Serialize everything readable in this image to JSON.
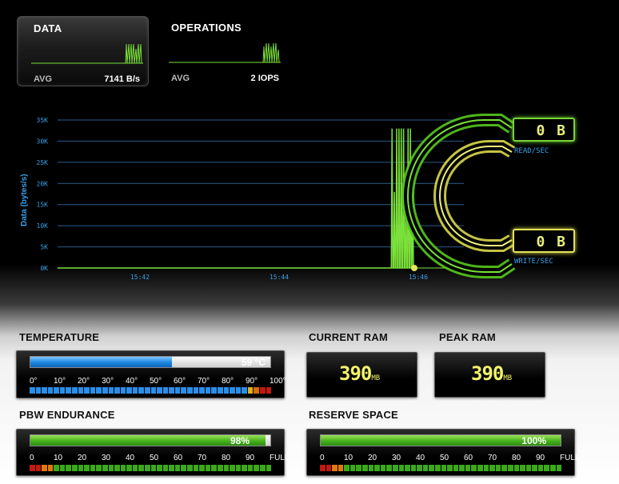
{
  "tabs": [
    {
      "title": "DATA",
      "avg_label": "AVG",
      "avg_value": "7141 B/s"
    },
    {
      "title": "OPERATIONS",
      "avg_label": "AVG",
      "avg_value": "2 IOPS"
    }
  ],
  "chart_data": {
    "type": "line",
    "ylabel": "Data (bytes/s)",
    "yticks": [
      "0K",
      "5K",
      "10K",
      "15K",
      "20K",
      "25K",
      "30K",
      "35K"
    ],
    "ylim": [
      0,
      35000
    ],
    "xticks": [
      "15:42",
      "15:44",
      "15:46"
    ],
    "series": [
      {
        "values": [
          0,
          0,
          0,
          0,
          0,
          0,
          0,
          0,
          0,
          0,
          0,
          0,
          0,
          0,
          0,
          0,
          0,
          0,
          0,
          0,
          0,
          0,
          0,
          0,
          0,
          0,
          0,
          0,
          0,
          0,
          0,
          0,
          0,
          0,
          0,
          0,
          0,
          0,
          0,
          0,
          0,
          0,
          0,
          0,
          0,
          0,
          0,
          0,
          0,
          0,
          0,
          0,
          0,
          0,
          0,
          0,
          0,
          0,
          0,
          0,
          0,
          0,
          0,
          0,
          0,
          0,
          0,
          0,
          0,
          0,
          0,
          0,
          0,
          0,
          0,
          0,
          0,
          0,
          0,
          0,
          0,
          0,
          0,
          0,
          0,
          0,
          0,
          0,
          0,
          0,
          0,
          0,
          0,
          0,
          0,
          0,
          0,
          0,
          0,
          0,
          0,
          0,
          0,
          0,
          0,
          0,
          0,
          0,
          0,
          0,
          0,
          0,
          0,
          0,
          0,
          0,
          0,
          0,
          0,
          0,
          0,
          0,
          0,
          0,
          0,
          0,
          0,
          0,
          0,
          0,
          0,
          0,
          0,
          0,
          0,
          0,
          0,
          0,
          0,
          0,
          0,
          0,
          0,
          0,
          0,
          0,
          0,
          0,
          0,
          0,
          0,
          0,
          0,
          0,
          0,
          0,
          0,
          0,
          0,
          0,
          0,
          0,
          0,
          0,
          0,
          0,
          0,
          0,
          0,
          0,
          0,
          0,
          0,
          0,
          0,
          0,
          0,
          0,
          0,
          0,
          0,
          0,
          0,
          0,
          0,
          0,
          0,
          0,
          0,
          0,
          0,
          0,
          0,
          0,
          0,
          0,
          0,
          0,
          0,
          0,
          0,
          0,
          0,
          0,
          0,
          0,
          0,
          0,
          0,
          0,
          0,
          0,
          0,
          0,
          0,
          0,
          0,
          0,
          0,
          0,
          0,
          0,
          0,
          0,
          0,
          0,
          0,
          0,
          0,
          0,
          0,
          0,
          0,
          0,
          0,
          0,
          0,
          0,
          0,
          0,
          0,
          0,
          0,
          0,
          0,
          0,
          0,
          0,
          0,
          0,
          0,
          0,
          0,
          0,
          0,
          0,
          0,
          0,
          0,
          0,
          0,
          0,
          0,
          0,
          0,
          0,
          0,
          0,
          0,
          0,
          0,
          0,
          0,
          0,
          0,
          0,
          0,
          0,
          0,
          0,
          0,
          0,
          0,
          0,
          0,
          0,
          0,
          0,
          0,
          0,
          0,
          0,
          0,
          0,
          0,
          0,
          0,
          0,
          0,
          0,
          0,
          0,
          0,
          0,
          0,
          0,
          0,
          0,
          0,
          0,
          0,
          0,
          0,
          0,
          0,
          0,
          0,
          0,
          0,
          0,
          0,
          0,
          0,
          0,
          0,
          0,
          0,
          0,
          0,
          0,
          0,
          0,
          0,
          0,
          0,
          0,
          0,
          0,
          0,
          0,
          0,
          0,
          0,
          0,
          0,
          0,
          0,
          0,
          0,
          0,
          0,
          0,
          0,
          0,
          0,
          0,
          0,
          0,
          0,
          0,
          0,
          0,
          0,
          0,
          0,
          0,
          0,
          0,
          0,
          0,
          0,
          0,
          0,
          0,
          0,
          0,
          0,
          0,
          0,
          0,
          0,
          0,
          0,
          0,
          0,
          0,
          0,
          0,
          0,
          0,
          0,
          0,
          0,
          0,
          0,
          0,
          0,
          0,
          0,
          0,
          0,
          0,
          0,
          0,
          0,
          0,
          0,
          0,
          0,
          0,
          0,
          0,
          0,
          0,
          0,
          0,
          0,
          0,
          0,
          0,
          0,
          0,
          0,
          0,
          0,
          0,
          0,
          0,
          0,
          0,
          0,
          0,
          0,
          0,
          0,
          0,
          0,
          33000,
          0,
          0,
          18000,
          0,
          0,
          33000,
          0,
          0,
          33000,
          0,
          0,
          33000,
          0,
          0,
          33000,
          0,
          0,
          21000,
          0,
          0,
          33000,
          0,
          0,
          33000,
          0,
          0,
          18000,
          0,
          0
        ],
        "color": "#7be03a"
      }
    ],
    "grid": true
  },
  "gauge": {
    "read_label": "READ/SEC",
    "read_value": "0 B",
    "write_label": "WRITE/SEC",
    "write_value": "0 B",
    "read_color": "#6ad82a",
    "write_color": "#e4e45c"
  },
  "temperature": {
    "title": "TEMPERATURE",
    "value_text": "59 °C",
    "fraction": 0.59,
    "scale": [
      "0°",
      "10°",
      "20°",
      "30°",
      "40°",
      "50°",
      "60°",
      "70°",
      "80°",
      "90°",
      "100°"
    ]
  },
  "current_ram": {
    "title": "CURRENT RAM",
    "value": "390",
    "unit": "MB"
  },
  "peak_ram": {
    "title": "PEAK RAM",
    "value": "390",
    "unit": "MB"
  },
  "pbw": {
    "title": "PBW ENDURANCE",
    "value_text": "98%",
    "fraction": 0.98,
    "scale": [
      "0",
      "10",
      "20",
      "30",
      "40",
      "50",
      "60",
      "70",
      "80",
      "90",
      "FULL"
    ]
  },
  "reserve": {
    "title": "RESERVE SPACE",
    "value_text": "100%",
    "fraction": 1.0,
    "scale": [
      "0",
      "10",
      "20",
      "30",
      "40",
      "50",
      "60",
      "70",
      "80",
      "90",
      "FULL"
    ]
  }
}
